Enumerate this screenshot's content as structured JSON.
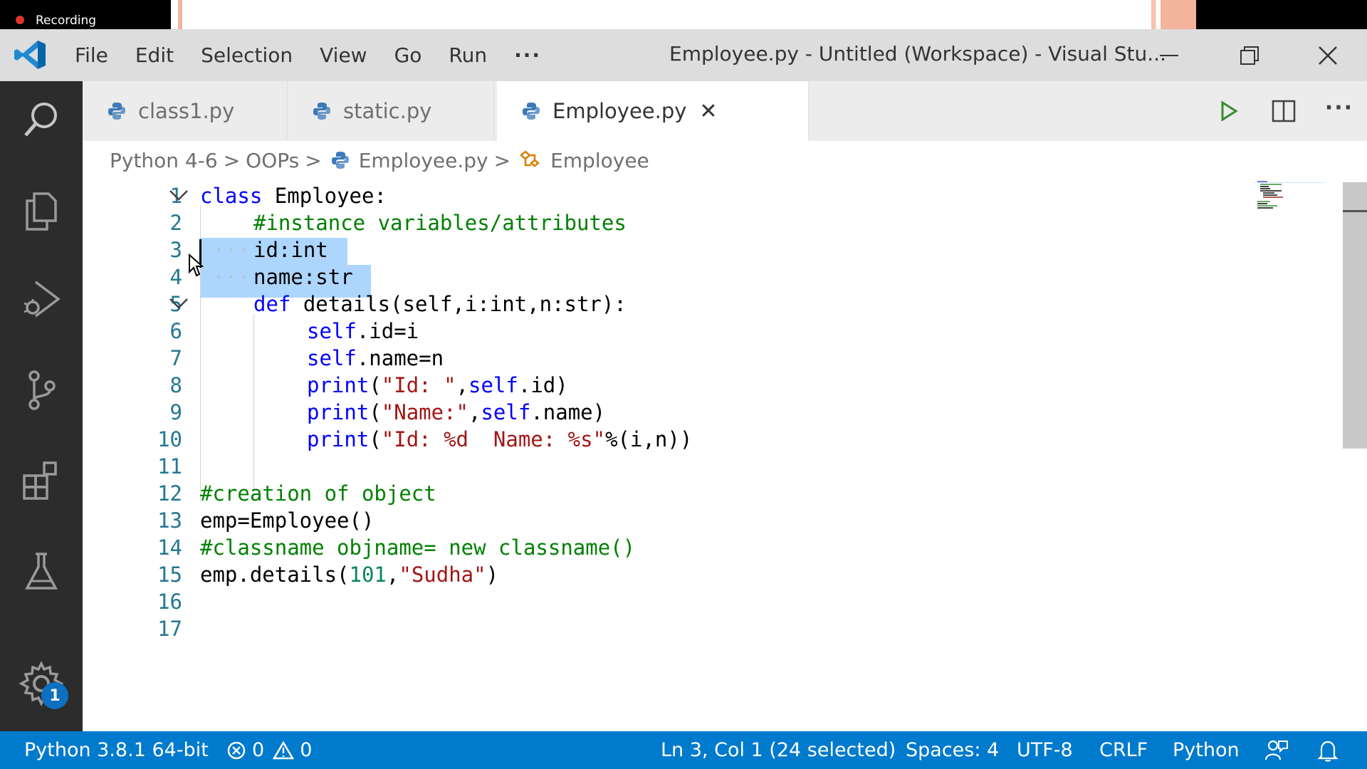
{
  "recording": {
    "label": "Recording"
  },
  "titlebar": {
    "menu": [
      "File",
      "Edit",
      "Selection",
      "View",
      "Go",
      "Run",
      "···"
    ],
    "title": "Employee.py - Untitled (Workspace) - Visual Stu..."
  },
  "activity": {
    "settings_badge": "1"
  },
  "tabs": [
    {
      "label": "class1.py"
    },
    {
      "label": "static.py"
    },
    {
      "label": "Employee.py",
      "close": "✕"
    }
  ],
  "breadcrumb": [
    "Python 4-6",
    "OOPs",
    "Employee.py",
    "Employee"
  ],
  "code_lines": [
    "class Employee:",
    "#instance variables/attributes",
    "id:int",
    "name:str",
    "def details(self,i:int,n:str):",
    "self.id=i",
    "self.name=n",
    "print(\"Id: \",self.id)",
    "print(\"Name:\",self.name)",
    "print(\"Id: %d  Name: %s\"%(i,n))",
    "",
    "#creation of object",
    "emp=Employee()",
    "#classname objname= new classname()",
    "emp.details(101,\"Sudha\")",
    "",
    ""
  ],
  "line_numbers": [
    "1",
    "2",
    "3",
    "4",
    "5",
    "6",
    "7",
    "8",
    "9",
    "10",
    "11",
    "12",
    "13",
    "14",
    "15",
    "16",
    "17"
  ],
  "statusbar": {
    "interpreter": "Python 3.8.1 64-bit",
    "errors": "0",
    "warnings": "0",
    "position": "Ln 3, Col 1 (24 selected)",
    "spaces": "Spaces: 4",
    "encoding": "UTF-8",
    "eol": "CRLF",
    "language": "Python"
  },
  "colors": {
    "statusbar": "#007acc",
    "activitybar": "#2c2c2c",
    "selection": "#add6ff",
    "keyword": "#0000ff",
    "comment": "#008000",
    "string": "#a31515",
    "number": "#098658"
  }
}
